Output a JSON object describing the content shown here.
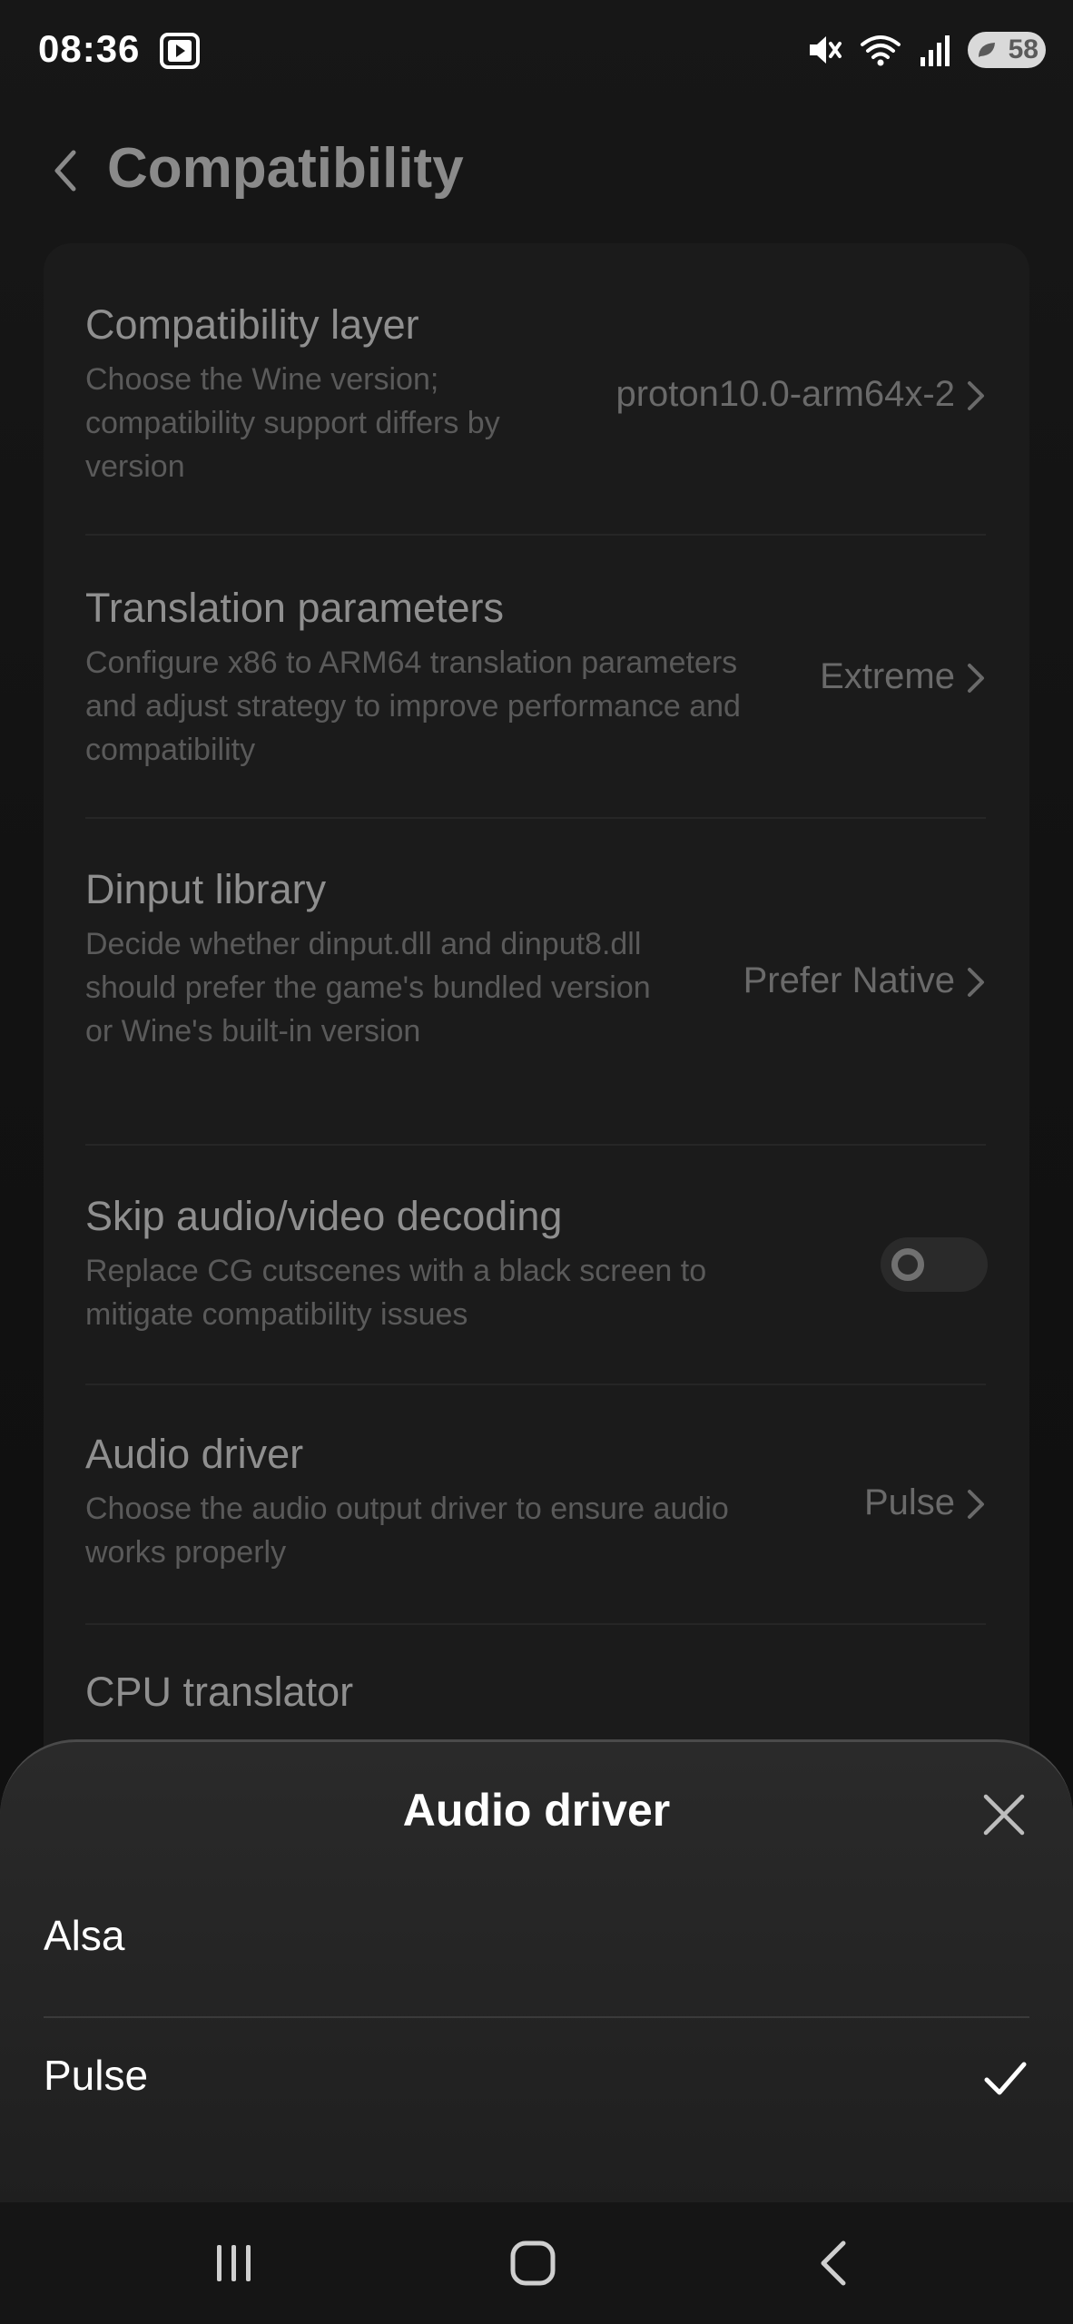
{
  "status_bar": {
    "time": "08:36",
    "battery": "58",
    "icons": [
      "youtube-icon",
      "mute-icon",
      "wifi-icon",
      "signal-icon",
      "battery-icon"
    ]
  },
  "header": {
    "title": "Compatibility",
    "back_icon": "chevron-left-icon"
  },
  "settings": [
    {
      "title": "Compatibility layer",
      "description": "Choose the Wine version; compatibility support differs by version",
      "value": "proton10.0-arm64x-2"
    },
    {
      "title": "Translation parameters",
      "description": "Configure x86 to ARM64 translation parameters and adjust strategy to improve performance and compatibility",
      "value": "Extreme"
    },
    {
      "title": "Dinput library",
      "description": "Decide whether dinput.dll and dinput8.dll should prefer the game's bundled version or Wine's built-in version",
      "value": "Prefer Native"
    },
    {
      "title": "Skip audio/video decoding",
      "description": "Replace CG cutscenes with a black screen to mitigate compatibility issues",
      "toggle_on": false
    },
    {
      "title": "Audio driver",
      "description": "Choose the audio output driver to ensure audio works properly",
      "value": "Pulse"
    },
    {
      "title": "CPU translator"
    }
  ],
  "sheet": {
    "title": "Audio driver",
    "options": [
      {
        "label": "Alsa",
        "selected": false
      },
      {
        "label": "Pulse",
        "selected": true
      }
    ]
  },
  "nav": {
    "buttons": [
      "recents-icon",
      "home-icon",
      "back-icon"
    ]
  }
}
